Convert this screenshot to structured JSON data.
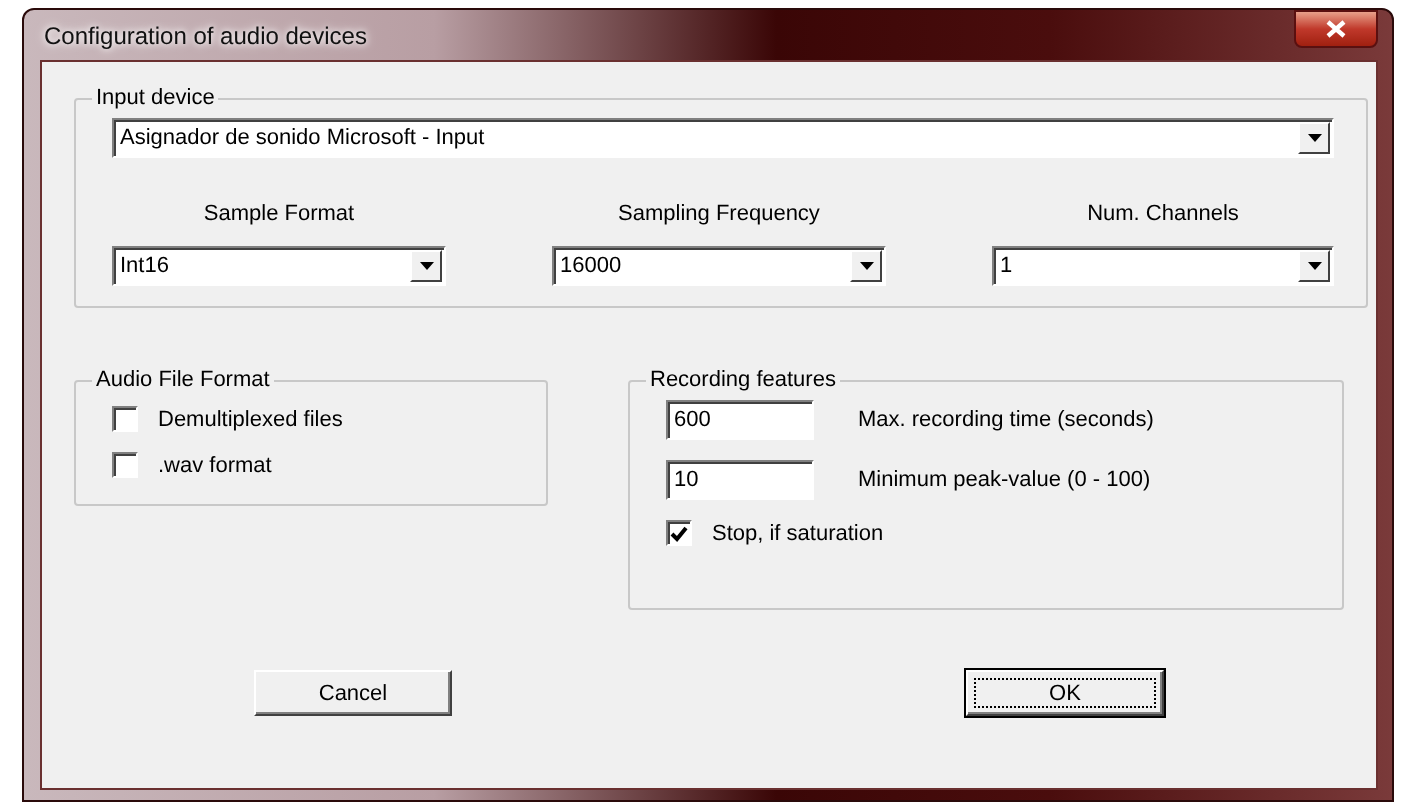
{
  "window": {
    "title": "Configuration of audio devices"
  },
  "input_device": {
    "legend": "Input device",
    "device": "Asignador de sonido Microsoft - Input",
    "fields": [
      {
        "label": "Sample Format",
        "value": "Int16"
      },
      {
        "label": "Sampling Frequency",
        "value": "16000"
      },
      {
        "label": "Num. Channels",
        "value": "1"
      }
    ]
  },
  "audio_file_format": {
    "legend": "Audio File Format",
    "options": [
      {
        "label": "Demultiplexed files",
        "checked": false
      },
      {
        "label": ".wav format",
        "checked": false
      }
    ]
  },
  "recording_features": {
    "legend": "Recording features",
    "fields": [
      {
        "value": "600",
        "label": "Max. recording time (seconds)"
      },
      {
        "value": "10",
        "label": "Minimum peak-value (0 - 100)"
      }
    ],
    "options": [
      {
        "label": "Stop, if saturation",
        "checked": true
      }
    ]
  },
  "buttons": [
    {
      "label": "Cancel",
      "focused": false
    },
    {
      "label": "OK",
      "focused": true
    }
  ]
}
